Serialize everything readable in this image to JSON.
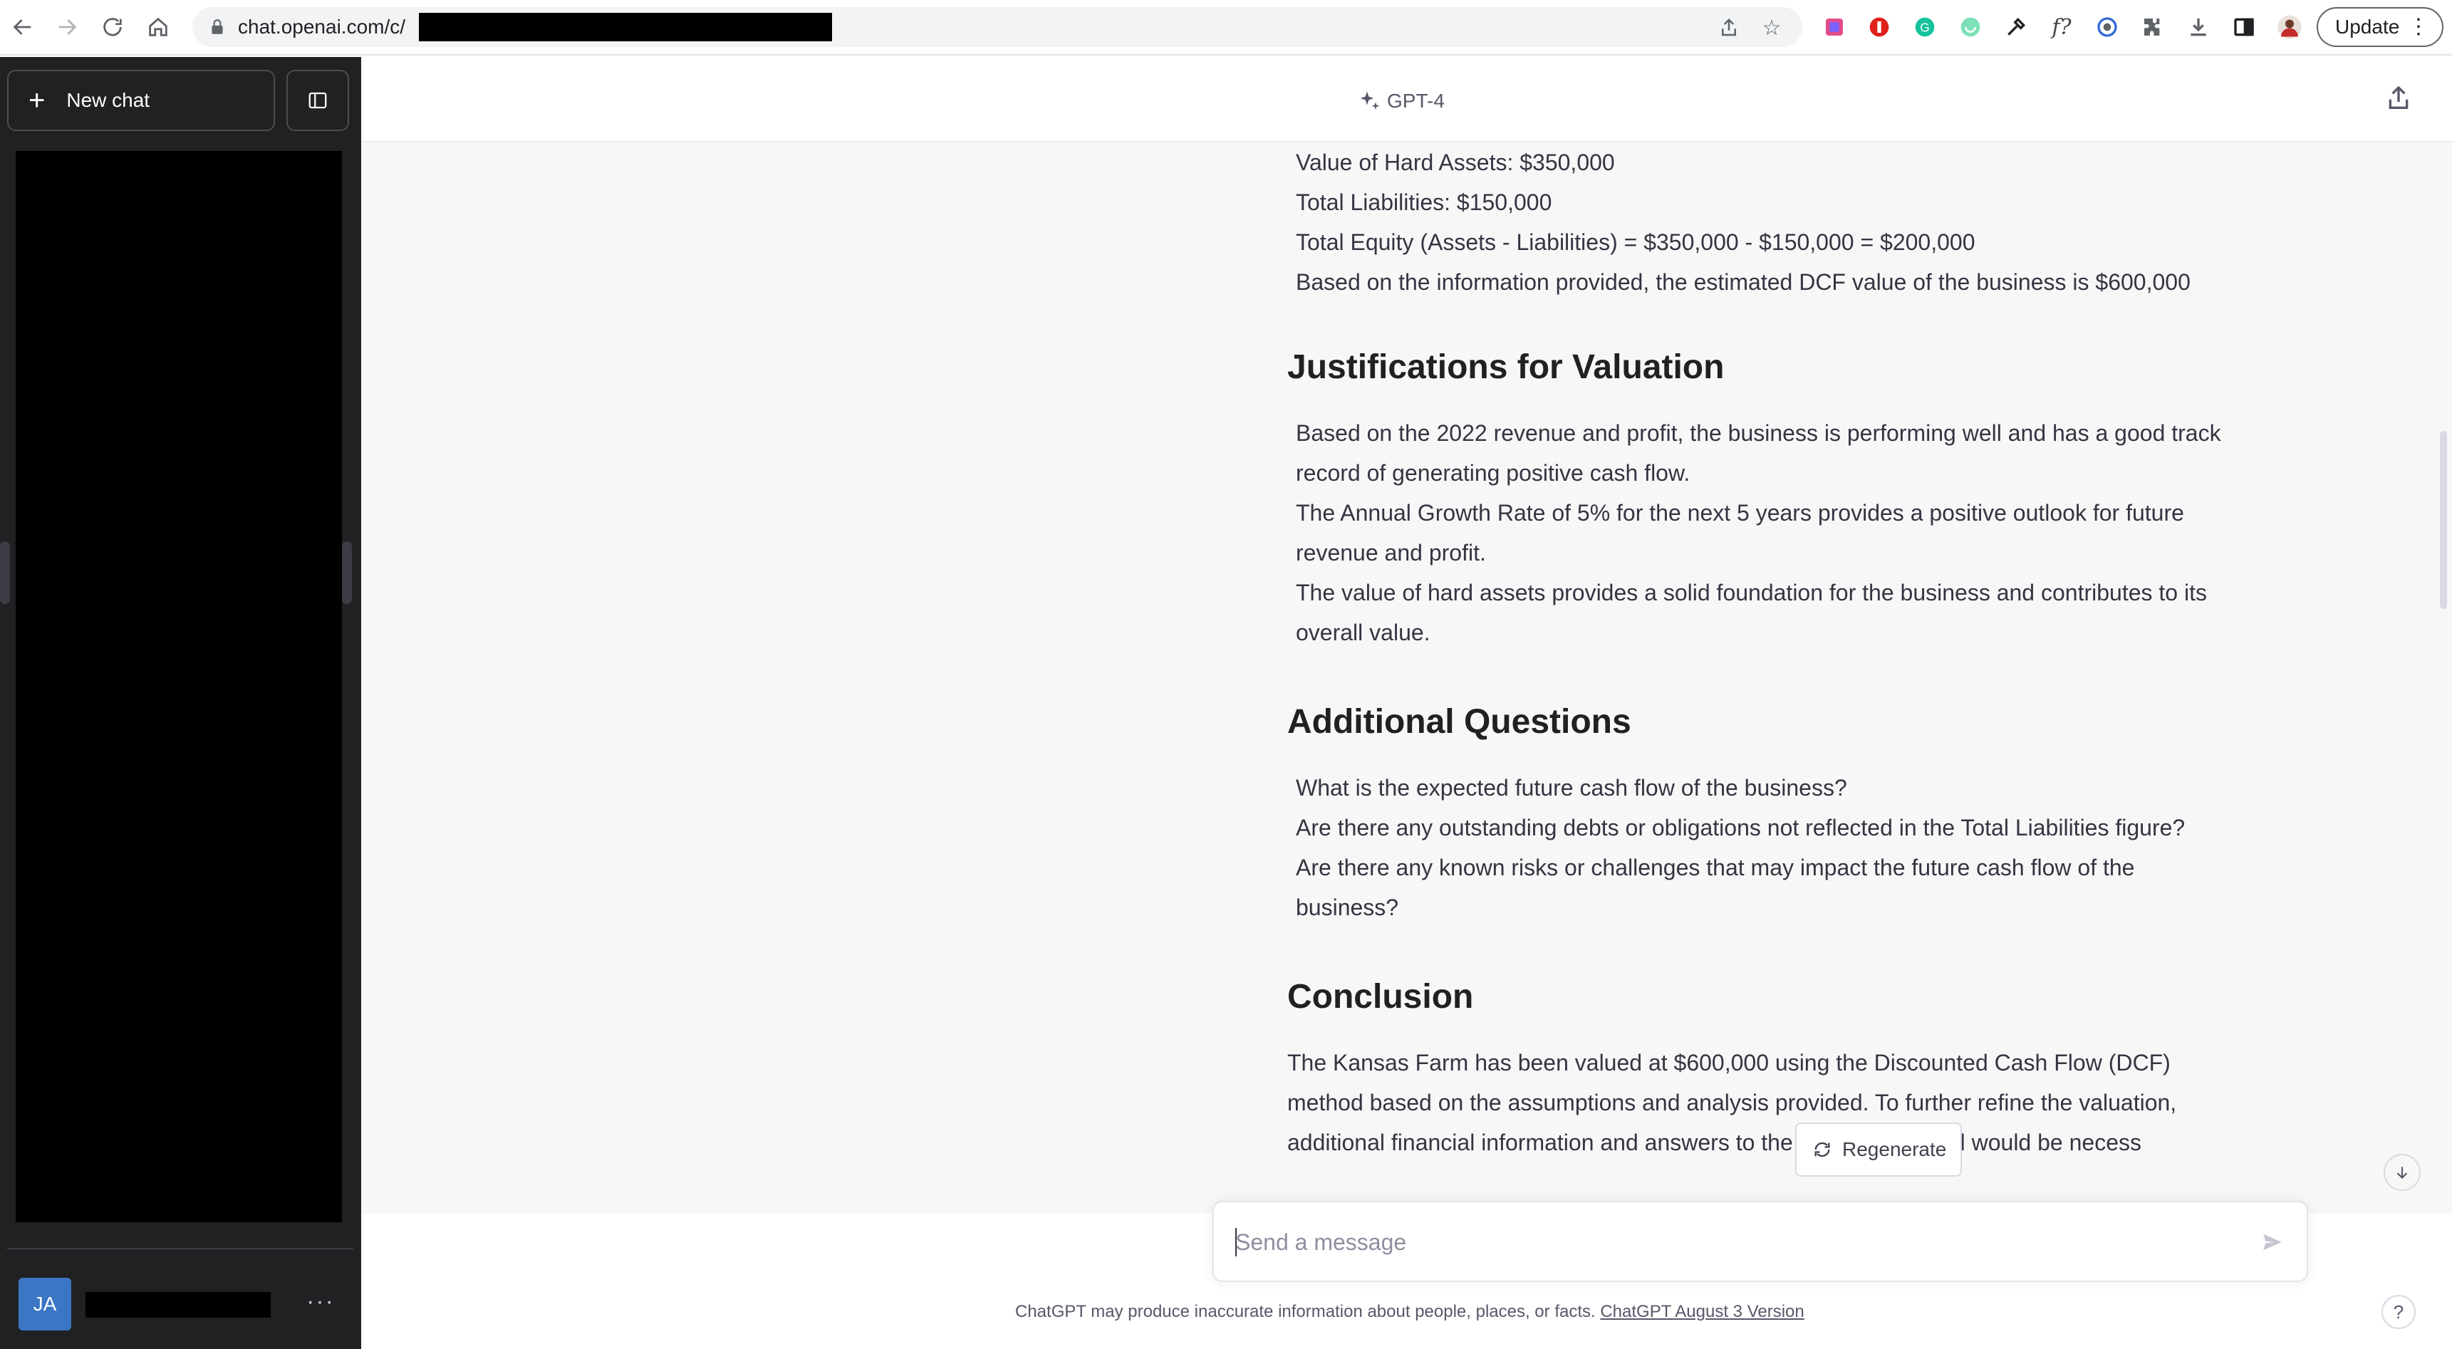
{
  "browser": {
    "url": "chat.openai.com/c/",
    "update_label": "Update",
    "extension_icons": [
      "slides-icon",
      "adblock-icon",
      "grammarly-icon",
      "refresh-circle-icon",
      "eyedropper-icon",
      "formula-icon",
      "privacy-icon",
      "puzzle-icon",
      "download-icon",
      "side-panel-icon",
      "profile-avatar-icon"
    ]
  },
  "sidebar": {
    "new_chat_label": "New chat",
    "user_initials": "JA"
  },
  "header": {
    "model": "GPT-4"
  },
  "conversation": {
    "summary_bullets": [
      "Value of Hard Assets: $350,000",
      "Total Liabilities: $150,000",
      "Total Equity (Assets - Liabilities) = $350,000 - $150,000 = $200,000",
      "Based on the information provided, the estimated DCF value of the business is $600,000"
    ],
    "justifications": {
      "heading": "Justifications for Valuation",
      "items": [
        "Based on the 2022 revenue and profit, the business is performing well and has a good track record of generating positive cash flow.",
        "The Annual Growth Rate of 5% for the next 5 years provides a positive outlook for future revenue and profit.",
        "The value of hard assets provides a solid foundation for the business and contributes to its overall value."
      ]
    },
    "questions": {
      "heading": "Additional Questions",
      "items": [
        "What is the expected future cash flow of the business?",
        "Are there any outstanding debts or obligations not reflected in the Total Liabilities figure?",
        "Are there any known risks or challenges that may impact the future cash flow of the business?"
      ]
    },
    "conclusion": {
      "heading": "Conclusion",
      "text": "The Kansas Farm has been valued at $600,000 using the Discounted Cash Flow (DCF) method based on the assumptions and analysis provided. To further refine the valuation, additional financial information and answers to the questions posed would be necess"
    }
  },
  "controls": {
    "regenerate_label": "Regenerate",
    "input_placeholder": "Send a message",
    "input_value": ""
  },
  "footer": {
    "disclaimer": "ChatGPT may produce inaccurate information about people, places, or facts.",
    "version_link": "ChatGPT August 3 Version",
    "help_label": "?"
  },
  "colors": {
    "sidebar_bg": "#202123",
    "main_bg": "#f7f7f8",
    "avatar_bg": "#3b76c5",
    "text": "#343541"
  }
}
